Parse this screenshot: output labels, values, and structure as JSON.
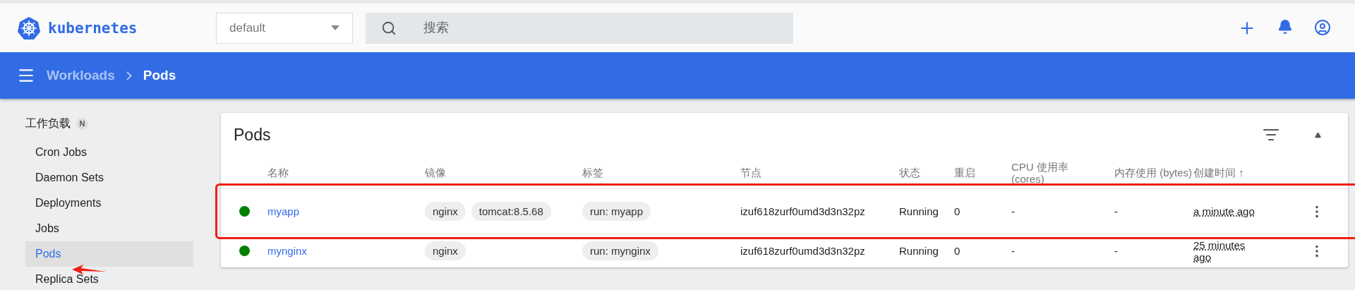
{
  "header": {
    "logo": "kubernetes",
    "namespace": "default",
    "search": {
      "placeholder": "搜索"
    }
  },
  "breadcrumb": [
    {
      "label": "Workloads",
      "current": false
    },
    {
      "label": "Pods",
      "current": true
    }
  ],
  "sidebar": {
    "section": "工作负载",
    "badge": "N",
    "items": [
      {
        "label": "Cron Jobs",
        "selected": false
      },
      {
        "label": "Daemon Sets",
        "selected": false
      },
      {
        "label": "Deployments",
        "selected": false
      },
      {
        "label": "Jobs",
        "selected": false
      },
      {
        "label": "Pods",
        "selected": true
      },
      {
        "label": "Replica Sets",
        "selected": false
      }
    ]
  },
  "card": {
    "title": "Pods",
    "columns": [
      "名称",
      "镜像",
      "标签",
      "节点",
      "状态",
      "重启",
      "CPU 使用率 (cores)",
      "内存使用 (bytes)",
      "创建时间 ↑"
    ],
    "rows": [
      {
        "color": "#008000",
        "name": "myapp",
        "images": [
          "nginx",
          "tomcat:8.5.68"
        ],
        "labels": [
          "run: myapp"
        ],
        "node": "izuf618zurf0umd3d3n32pz",
        "status": "Running",
        "restarts": "0",
        "cpu": "-",
        "memory": "-",
        "created": "a minute ago",
        "highlighted": true
      },
      {
        "color": "#008000",
        "name": "mynginx",
        "images": [
          "nginx"
        ],
        "labels": [
          "run: mynginx"
        ],
        "node": "izuf618zurf0umd3d3n32pz",
        "status": "Running",
        "restarts": "0",
        "cpu": "-",
        "memory": "-",
        "created": "25 minutes ago",
        "highlighted": false
      }
    ]
  }
}
